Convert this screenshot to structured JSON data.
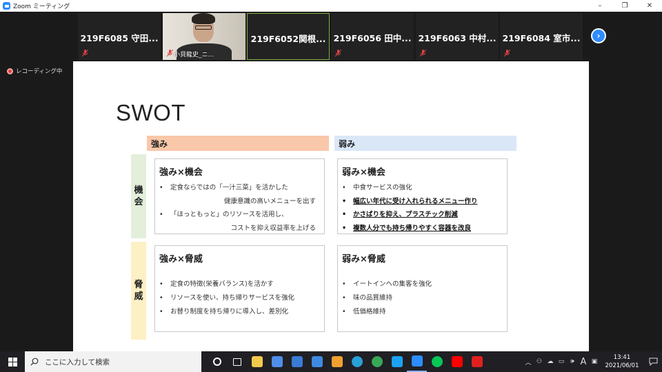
{
  "window": {
    "title": "Zoom ミーティング",
    "minimize": "–",
    "maximize": "❐",
    "close": "✕"
  },
  "gallery": {
    "tiles": [
      {
        "name": "219F6085 守田..."
      },
      {
        "name": "小貝龍史_ニ..."
      },
      {
        "name": "219F6052関根..."
      },
      {
        "name": "219F6056 田中..."
      },
      {
        "name": "219F6063 中村..."
      },
      {
        "name": "219F6084 室市..."
      }
    ],
    "next": "›"
  },
  "recording": {
    "label": "レコーディング中"
  },
  "slide": {
    "title": "SWOT",
    "col_strength": "強み",
    "col_weakness": "弱み",
    "row_opportunity": [
      "機",
      "会"
    ],
    "row_threat": [
      "脅",
      "威"
    ],
    "so": {
      "title": "強み×機会",
      "items": [
        "定食ならではの「一汁三菜」を活かした",
        "健康意識の高いメニューを出す",
        "「ほっともっと」のリソースを活用し、",
        "コストを抑え収益率を上げる"
      ]
    },
    "wo": {
      "title": "弱み×機会",
      "items": [
        "中食サービスの強化",
        "幅広い年代に受け入れられるメニュー作り",
        "かさばりを抑え、プラスチック削減",
        "複数人分でも持ち帰りやすく容器を改良"
      ]
    },
    "st": {
      "title": "強み×脅威",
      "items": [
        "定食の特徴(栄養バランス)を活かす",
        "リソースを使い、持ち帰りサービスを強化",
        "お替り制度を持ち帰りに導入し、差別化"
      ]
    },
    "wt": {
      "title": "弱み×脅威",
      "items": [
        "イートインへの集客を強化",
        "味の品質維持",
        "低価格維持"
      ]
    }
  },
  "taskbar": {
    "search_placeholder": "ここに入力して検索",
    "icons": [
      "cortana-icon",
      "task-view-icon",
      "file-explorer-icon",
      "store-icon",
      "mail-at-icon",
      "mail-icon",
      "media-icon",
      "edge-icon",
      "chrome-icon",
      "twitter-icon",
      "zoom-icon",
      "line-icon",
      "youtube-icon",
      "acrobat-icon"
    ],
    "icon_colors": [
      "#ffffff",
      "#ffffff",
      "#f2c94c",
      "#4e8ee8",
      "#3a7bd5",
      "#3f8ae0",
      "#f0a030",
      "#2aa0d8",
      "#3aa757",
      "#1da1f2",
      "#2d8cff",
      "#06c755",
      "#ff0000",
      "#e02020"
    ],
    "tray_ime": "A",
    "clock_time": "13:41",
    "clock_date": "2021/06/01"
  }
}
